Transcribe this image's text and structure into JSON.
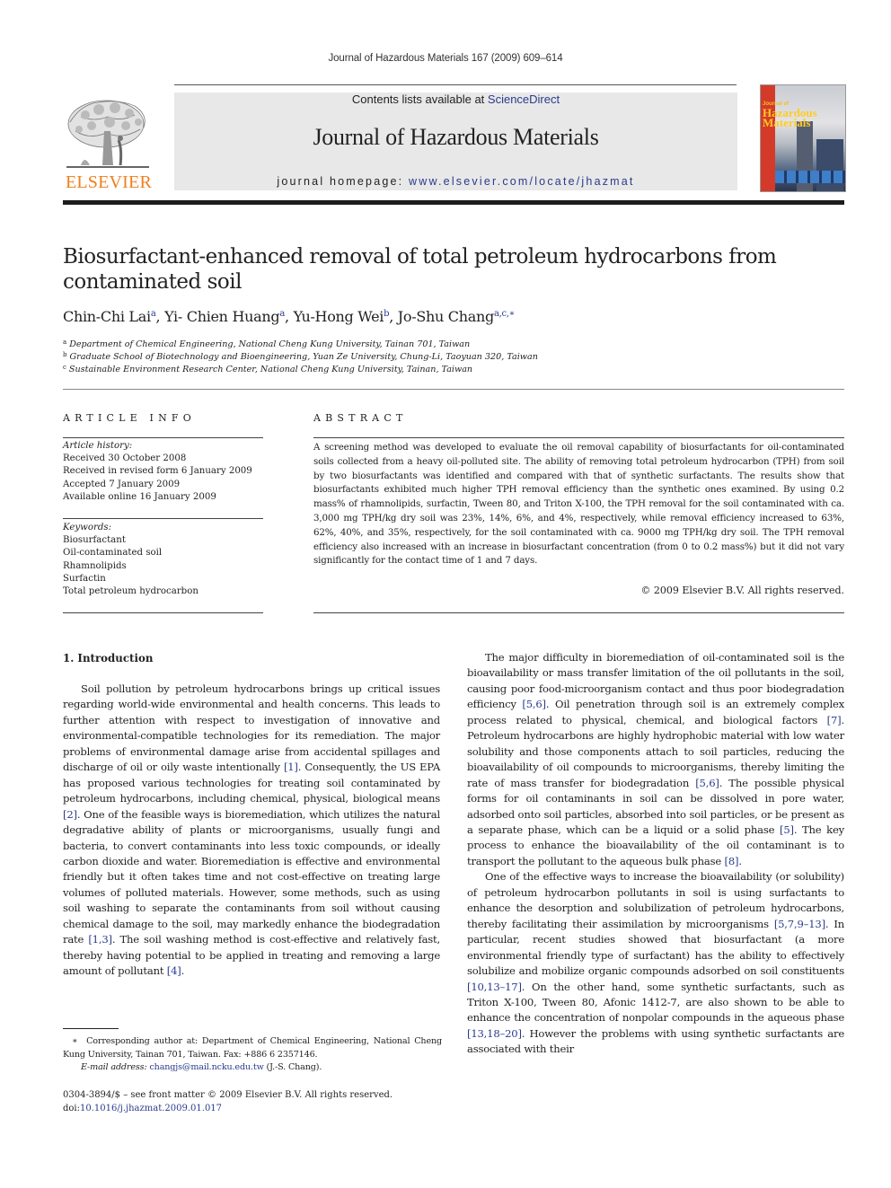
{
  "running_head": "Journal of Hazardous Materials 167 (2009) 609–614",
  "publisher": {
    "name": "ELSEVIER",
    "logo_icon": "elsevier-tree-logo",
    "brand_color": "#f07f1c"
  },
  "masthead": {
    "contents_prefix": "Contents lists available at ",
    "contents_link": "ScienceDirect",
    "journal_title": "Journal of Hazardous Materials",
    "homepage_prefix": "journal homepage: ",
    "homepage_url": "www.elsevier.com/locate/jhazmat",
    "link_color": "#2a3a8c",
    "cover": {
      "icon": "journal-cover-image",
      "line1": "Journal of",
      "line2": "Hazardous",
      "line3": "Materials"
    }
  },
  "article": {
    "title_line1": "Biosurfactant-enhanced removal of total petroleum hydrocarbons from",
    "title_line2": "contaminated soil",
    "authors": [
      {
        "name": "Chin-Chi Lai",
        "sup": "a",
        "sep": ", "
      },
      {
        "name": "Yi- Chien Huang",
        "sup": "a",
        "sep": ", "
      },
      {
        "name": "Yu-Hong Wei",
        "sup": "b",
        "sep": ", "
      },
      {
        "name": "Jo-Shu Chang",
        "sup": "a,c,∗",
        "sep": ""
      }
    ],
    "affiliations": [
      {
        "mark": "a",
        "text": "Department of Chemical Engineering, National Cheng Kung University, Tainan 701, Taiwan"
      },
      {
        "mark": "b",
        "text": "Graduate School of Biotechnology and Bioengineering, Yuan Ze University, Chung-Li, Taoyuan 320, Taiwan"
      },
      {
        "mark": "c",
        "text": "Sustainable Environment Research Center, National Cheng Kung University, Tainan, Taiwan"
      }
    ]
  },
  "article_info": {
    "heading": "ARTICLE INFO",
    "history_label": "Article history:",
    "history": [
      "Received 30 October 2008",
      "Received in revised form 6 January 2009",
      "Accepted 7 January 2009",
      "Available online 16 January 2009"
    ],
    "keywords_label": "Keywords:",
    "keywords": [
      "Biosurfactant",
      "Oil-contaminated soil",
      "Rhamnolipids",
      "Surfactin",
      "Total petroleum hydrocarbon"
    ]
  },
  "abstract": {
    "heading": "ABSTRACT",
    "text": "A screening method was developed to evaluate the oil removal capability of biosurfactants for oil-contaminated soils collected from a heavy oil-polluted site. The ability of removing total petroleum hydrocarbon (TPH) from soil by two biosurfactants was identified and compared with that of synthetic surfactants. The results show that biosurfactants exhibited much higher TPH removal efficiency than the synthetic ones examined. By using 0.2 mass% of rhamnolipids, surfactin, Tween 80, and Triton X-100, the TPH removal for the soil contaminated with ca. 3,000 mg TPH/kg dry soil was 23%, 14%, 6%, and 4%, respectively, while removal efficiency increased to 63%, 62%, 40%, and 35%, respectively, for the soil contaminated with ca. 9000 mg TPH/kg dry soil. The TPH removal efficiency also increased with an increase in biosurfactant concentration (from 0 to 0.2 mass%) but it did not vary significantly for the contact time of 1 and 7 days.",
    "copyright": "© 2009 Elsevier B.V. All rights reserved."
  },
  "section1": {
    "heading": "1.  Introduction",
    "left_para": [
      {
        "t": "Soil pollution by petroleum hydrocarbons brings up critical issues regarding world-wide environmental and health concerns. This leads to further attention with respect to investigation of innovative and environmental-compatible technologies for its remediation. The major problems of environmental damage arise from accidental spillages and discharge of oil or oily waste intentionally "
      },
      {
        "r": "[1]"
      },
      {
        "t": ". Consequently, the US EPA has proposed various technologies for treating soil contaminated by petroleum hydrocarbons, including chemical, physical, biological means "
      },
      {
        "r": "[2]"
      },
      {
        "t": ". One of the feasible ways is bioremediation, which utilizes the natural degradative ability of plants or microorganisms, usually fungi and bacteria, to convert contaminants into less toxic compounds, or ideally carbon dioxide and water. Bioremediation is effective and environmental friendly but it often takes time and not cost-effective on treating large volumes of polluted materials. However, some methods, such as using soil washing to separate the contaminants from soil without causing chemical damage to the soil, may markedly enhance the biodegradation rate "
      },
      {
        "r": "[1,3]"
      },
      {
        "t": ". The soil washing method is cost-effective and relatively fast, thereby having potential to be applied in treating and removing a large amount of pollutant "
      },
      {
        "r": "[4]"
      },
      {
        "t": "."
      }
    ],
    "right_para1": [
      {
        "t": "The major difficulty in bioremediation of oil-contaminated soil is the bioavailability or mass transfer limitation of the oil pollutants in the soil, causing poor food-microorganism contact and thus poor biodegradation efficiency "
      },
      {
        "r": "[5,6]"
      },
      {
        "t": ". Oil penetration through soil is an extremely complex process related to physical, chemical, and biological factors "
      },
      {
        "r": "[7]"
      },
      {
        "t": ". Petroleum hydrocarbons are highly hydrophobic material with low water solubility and those components attach to soil particles, reducing the bioavailability of oil compounds to microorganisms, thereby limiting the rate of mass transfer for biodegradation "
      },
      {
        "r": "[5,6]"
      },
      {
        "t": ". The possible physical forms for oil contaminants in soil can be dissolved in pore water, adsorbed onto soil particles, absorbed into soil particles, or be present as a separate phase, which can be a liquid or a solid phase "
      },
      {
        "r": "[5]"
      },
      {
        "t": ". The key process to enhance the bioavailability of the oil contaminant is to transport the pollutant to the aqueous bulk phase "
      },
      {
        "r": "[8]"
      },
      {
        "t": "."
      }
    ],
    "right_para2": [
      {
        "t": "One of the effective ways to increase the bioavailability (or solubility) of petroleum hydrocarbon pollutants in soil is using surfactants to enhance the desorption and solubilization of petroleum hydrocarbons, thereby facilitating their assimilation by microorganisms "
      },
      {
        "r": "[5,7,9–13]"
      },
      {
        "t": ". In particular, recent studies showed that biosurfactant (a more environmental friendly type of surfactant) has the ability to effectively solubilize and mobilize organic compounds adsorbed on soil constituents "
      },
      {
        "r": "[10,13–17]"
      },
      {
        "t": ". On the other hand, some synthetic surfactants, such as Triton X-100, Tween 80, Afonic 1412-7, are also shown to be able to enhance the concentration of nonpolar compounds in the aqueous phase "
      },
      {
        "r": "[13,18–20]"
      },
      {
        "t": ". However the problems with using synthetic surfactants are associated with their"
      }
    ]
  },
  "footnote": {
    "star": "∗",
    "corresponding": "Corresponding author at: Department of Chemical Engineering, National Cheng Kung University, Tainan 701, Taiwan. Fax: +886 6 2357146.",
    "email_label": "E-mail address:",
    "email": "changjs@mail.ncku.edu.tw",
    "email_suffix": " (J.-S. Chang)."
  },
  "front_matter": {
    "issn_line": "0304-3894/$ – see front matter © 2009 Elsevier B.V. All rights reserved.",
    "doi_label": "doi:",
    "doi": "10.1016/j.jhazmat.2009.01.017"
  }
}
